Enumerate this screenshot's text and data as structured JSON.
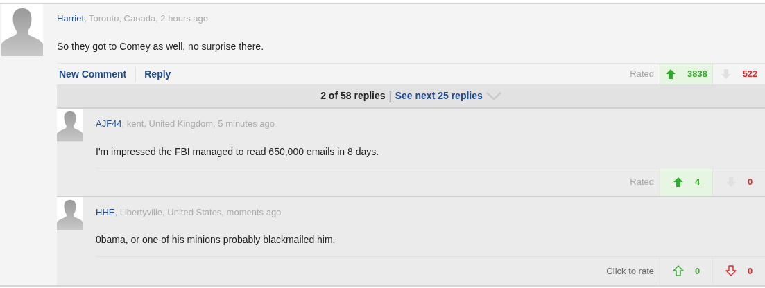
{
  "comment": {
    "author": "Harriet",
    "meta": ", Toronto, Canada, 2 hours ago",
    "body": "So they got to Comey as well, no surprise there.",
    "actions": [
      "New Comment",
      "Reply"
    ],
    "rating": {
      "kind": "rated_up",
      "label": "Rated",
      "up": "3838",
      "down": "522"
    }
  },
  "replies_bar": {
    "count": "2 of 58 replies",
    "separator": "|",
    "next_link": "See next 25 replies"
  },
  "replies": [
    {
      "author": "AJF44",
      "meta": ", kent, United Kingdom, 5 minutes ago",
      "body": "I'm impressed the FBI managed to read 650,000 emails in 8 days.",
      "rating": {
        "kind": "rated_up",
        "label": "Rated",
        "up": "4",
        "down": "0"
      }
    },
    {
      "author": "HHE",
      "meta": ", Libertyville, United States, moments ago",
      "body": "0bama, or one of his minions probably blackmailed him.",
      "rating": {
        "kind": "unrated",
        "label": "Click to rate",
        "up": "0",
        "down": "0"
      }
    }
  ]
}
